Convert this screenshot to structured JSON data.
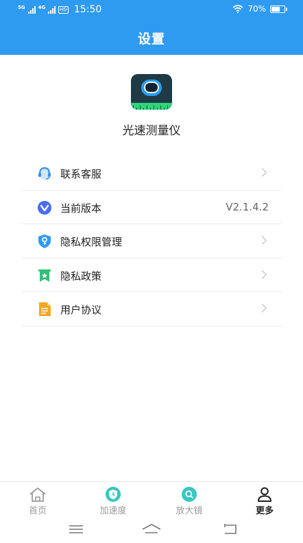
{
  "status_bar": {
    "sim1": "5G",
    "sim2": "4G",
    "hd": "HD",
    "time": "15:50",
    "battery": "70%",
    "battery_level": 0.7
  },
  "header": {
    "title": "设置"
  },
  "app": {
    "name": "光速测量仪"
  },
  "menu": {
    "items": [
      {
        "label": "联系客服",
        "icon": "headset-icon",
        "color": "#3a8ee8"
      },
      {
        "label": "当前版本",
        "icon": "version-icon",
        "color": "#4a6cf0",
        "value": "V2.1.4.2"
      },
      {
        "label": "隐私权限管理",
        "icon": "key-shield-icon",
        "color": "#2f9bf0"
      },
      {
        "label": "隐私政策",
        "icon": "bookmark-icon",
        "color": "#34c07a"
      },
      {
        "label": "用户协议",
        "icon": "document-icon",
        "color": "#f5a623"
      }
    ]
  },
  "tabbar": {
    "items": [
      {
        "label": "首页",
        "icon": "home-icon"
      },
      {
        "label": "加速度",
        "icon": "speed-icon"
      },
      {
        "label": "放大镜",
        "icon": "magnifier-icon"
      },
      {
        "label": "更多",
        "icon": "user-icon",
        "active": true
      }
    ]
  },
  "colors": {
    "primary": "#2f9bf0",
    "accent_teal": "#37c8c2",
    "text": "#222222",
    "muted": "#9a9a9a"
  }
}
